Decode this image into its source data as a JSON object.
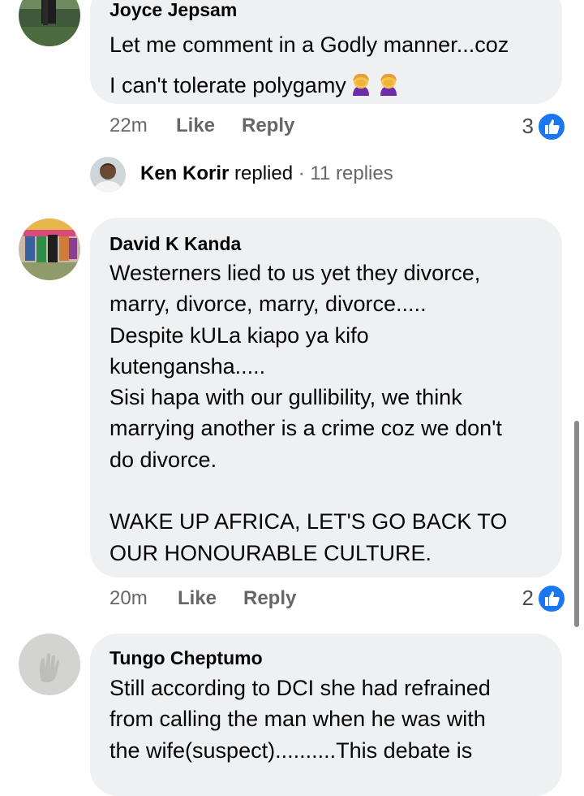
{
  "comments": [
    {
      "author": "Joyce Jepsam",
      "lines": [
        "Let me comment in a Godly manner...coz",
        "I can't tolerate polygamy"
      ],
      "emoji": [
        "facepalm-woman-emoji",
        "facepalm-woman-emoji"
      ],
      "time": "22m",
      "like_label": "Like",
      "reply_label": "Reply",
      "reactions": "3"
    },
    {
      "author": "David K Kanda",
      "lines": [
        "Westerners lied to us yet they divorce,",
        "marry, divorce, marry, divorce.....",
        "Despite kULa kiapo ya kifo",
        "kutengansha.....",
        "Sisi hapa with our gullibility, we think",
        "marrying another is a crime coz we don't",
        "do divorce.",
        "",
        "WAKE UP AFRICA, LET'S GO BACK TO",
        "OUR HONOURABLE CULTURE."
      ],
      "time": "20m",
      "like_label": "Like",
      "reply_label": "Reply",
      "reactions": "2"
    },
    {
      "author": "Tungo Cheptumo",
      "lines": [
        "Still according to DCI she had refrained",
        "from calling the man when he was with",
        "the wife(suspect)..........This debate is"
      ]
    }
  ],
  "reply_thread": {
    "name": "Ken Korir",
    "action": "replied",
    "separator": "·",
    "count": "11 replies"
  },
  "colors": {
    "bubble": "#eff0f2",
    "meta_text": "#65676b",
    "like_blue": "#1a77f2"
  }
}
